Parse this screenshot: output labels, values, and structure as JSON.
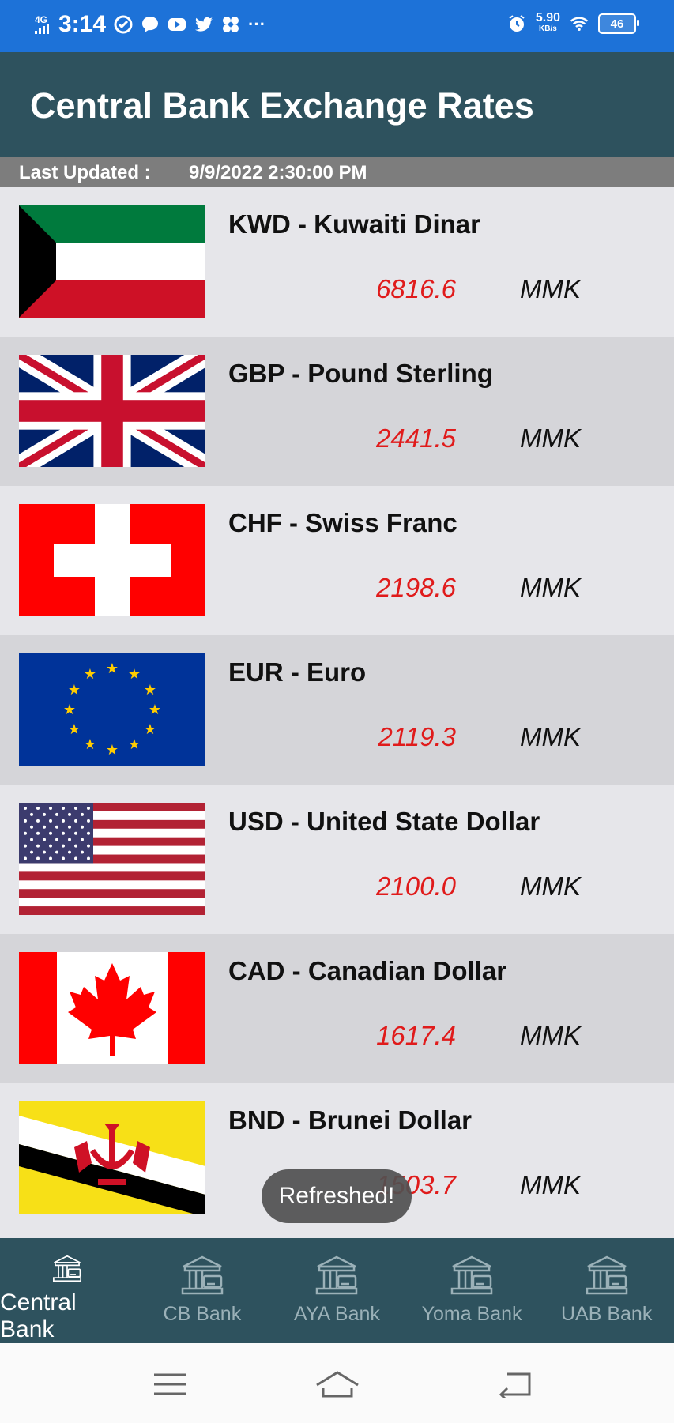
{
  "status_bar": {
    "network": "4G",
    "time": "3:14",
    "speed_value": "5.90",
    "speed_unit": "KB/s",
    "battery": "46",
    "more": "···"
  },
  "header": {
    "title": "Central Bank Exchange Rates"
  },
  "updated": {
    "label": "Last Updated :",
    "value": "9/9/2022 2:30:00 PM"
  },
  "rates": [
    {
      "name": "KWD - Kuwaiti Dinar",
      "rate": "6816.6",
      "unit": "MMK",
      "flag": "kuwait-flag"
    },
    {
      "name": "GBP - Pound Sterling",
      "rate": "2441.5",
      "unit": "MMK",
      "flag": "uk-flag"
    },
    {
      "name": "CHF - Swiss Franc",
      "rate": "2198.6",
      "unit": "MMK",
      "flag": "swiss-flag"
    },
    {
      "name": "EUR - Euro",
      "rate": "2119.3",
      "unit": "MMK",
      "flag": "eu-flag"
    },
    {
      "name": "USD - United State Dollar",
      "rate": "2100.0",
      "unit": "MMK",
      "flag": "us-flag"
    },
    {
      "name": "CAD - Canadian Dollar",
      "rate": "1617.4",
      "unit": "MMK",
      "flag": "canada-flag"
    },
    {
      "name": "BND - Brunei Dollar",
      "rate": "1503.7",
      "unit": "MMK",
      "flag": "brunei-flag"
    }
  ],
  "toast": {
    "text": "Refreshed!"
  },
  "nav": [
    {
      "label": "Central Bank",
      "icon": "bank-icon",
      "active": true
    },
    {
      "label": "CB Bank",
      "icon": "bank-icon",
      "active": false
    },
    {
      "label": "AYA Bank",
      "icon": "bank-icon",
      "active": false
    },
    {
      "label": "Yoma Bank",
      "icon": "bank-icon",
      "active": false
    },
    {
      "label": "UAB Bank",
      "icon": "bank-icon",
      "active": false
    }
  ],
  "colors": {
    "header_bg": "#2e525e",
    "status_bg": "#1d72d8",
    "rate_red": "#e01b1b",
    "updated_bg": "#7d7d7d"
  }
}
